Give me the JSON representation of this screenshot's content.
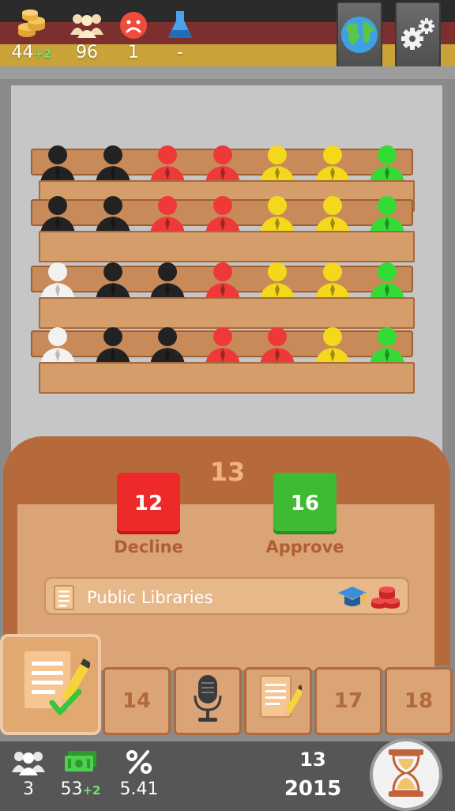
{
  "top_bar": {
    "money": {
      "icon": "coins-icon",
      "value": "44",
      "delta": "+2"
    },
    "population": {
      "icon": "crowd-icon",
      "value": "96"
    },
    "unhappiness": {
      "icon": "sad-face-icon",
      "value": "1"
    },
    "research": {
      "icon": "flask-icon",
      "value": "-"
    },
    "world_button": {
      "icon": "globe-icon"
    },
    "settings_button": {
      "icon": "gears-icon"
    },
    "flag_colors": [
      "#2b2b2b",
      "#7b2f2f",
      "#c9a338"
    ]
  },
  "parliament": {
    "party_colors": {
      "black": "#222222",
      "white": "#f2f2f2",
      "red": "#ef3838",
      "yellow": "#f4d81c",
      "green": "#35db35"
    },
    "rows": [
      [
        {
          "party": "black",
          "vote": "yes",
          "star": true
        },
        {
          "party": "black",
          "vote": "yes",
          "star": false
        },
        {
          "party": "red",
          "vote": "yes",
          "star": false
        },
        {
          "party": "red",
          "vote": "yes",
          "star": false
        },
        {
          "party": "yellow",
          "vote": "no",
          "star": false
        },
        {
          "party": "yellow",
          "vote": "no",
          "star": false
        },
        {
          "party": "green",
          "vote": "no",
          "star": false
        }
      ],
      [
        {
          "party": "black",
          "vote": "no",
          "star": false
        },
        {
          "party": "black",
          "vote": "yes",
          "star": false
        },
        {
          "party": "red",
          "vote": "no",
          "star": true
        },
        {
          "party": "red",
          "vote": "no",
          "star": false
        },
        {
          "party": "yellow",
          "vote": "no",
          "star": false
        },
        {
          "party": "yellow",
          "vote": "no",
          "star": false
        },
        {
          "party": "green",
          "vote": "yes",
          "star": true
        }
      ],
      [
        {
          "party": "white",
          "vote": "yes",
          "star": false
        },
        {
          "party": "black",
          "vote": "yes",
          "star": false
        },
        {
          "party": "black",
          "vote": "yes",
          "star": false
        },
        {
          "party": "red",
          "vote": "no",
          "star": false
        },
        {
          "party": "yellow",
          "vote": "no",
          "star": true
        },
        {
          "party": "yellow",
          "vote": "yes",
          "star": false
        },
        {
          "party": "green",
          "vote": "yes",
          "star": false
        }
      ],
      [
        {
          "party": "white",
          "vote": "yes",
          "star": true
        },
        {
          "party": "black",
          "vote": "yes",
          "star": false
        },
        {
          "party": "black",
          "vote": "yes",
          "star": false
        },
        {
          "party": "red",
          "vote": "no",
          "star": false
        },
        {
          "party": "red",
          "vote": "yes",
          "star": false
        },
        {
          "party": "yellow",
          "vote": "no",
          "star": false
        },
        {
          "party": "green",
          "vote": "yes",
          "star": false
        }
      ]
    ]
  },
  "bill_panel": {
    "total_votes": "13",
    "decline": {
      "count": "12",
      "label": "Decline",
      "color": "#ee2929"
    },
    "approve": {
      "count": "16",
      "label": "Approve",
      "color": "#3fbb33"
    },
    "bill": {
      "icon": "document-icon",
      "name": "Public Libraries",
      "tags": [
        "graduation-cap-icon",
        "money-stack-icon"
      ]
    }
  },
  "action_slots": [
    {
      "icon": "sign-bill-icon",
      "label": "",
      "active": true
    },
    {
      "label": "14"
    },
    {
      "icon": "microphone-icon",
      "label": ""
    },
    {
      "icon": "draft-bill-icon",
      "label": ""
    },
    {
      "label": "17"
    },
    {
      "label": "18"
    }
  ],
  "bottom_bar": {
    "seats": {
      "icon": "people-icon",
      "value": "3"
    },
    "budget": {
      "icon": "cash-icon",
      "value": "53",
      "delta": "+2"
    },
    "rate": {
      "icon": "percent-icon",
      "value": "5.41"
    },
    "turn": "13",
    "year": "2015",
    "end_turn_button": {
      "icon": "hourglass-icon"
    }
  }
}
